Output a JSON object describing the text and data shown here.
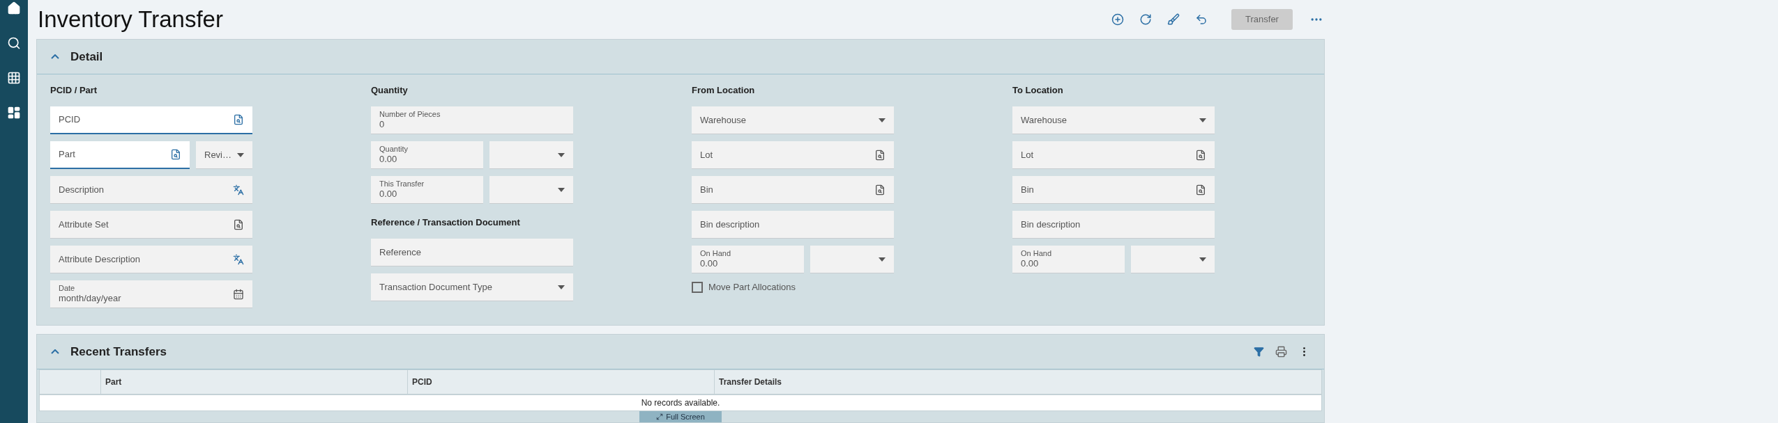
{
  "page": {
    "title": "Inventory Transfer"
  },
  "toolbar": {
    "transfer_button": {
      "label": "Transfer",
      "disabled": true
    }
  },
  "detail": {
    "title": "Detail",
    "expanded": true,
    "columns": [
      {
        "items": [
          {
            "kind": "heading",
            "text": "PCID / Part"
          },
          {
            "kind": "row",
            "fields": [
              {
                "kind": "lookup",
                "placeholder": "PCID",
                "active": true
              }
            ]
          },
          {
            "kind": "row",
            "fields": [
              {
                "kind": "lookup",
                "placeholder": "Part",
                "active": true
              },
              {
                "kind": "select",
                "placeholder": "Revi…",
                "active": false
              }
            ]
          },
          {
            "kind": "row",
            "fields": [
              {
                "kind": "translate",
                "placeholder": "Description",
                "active": false
              }
            ]
          },
          {
            "kind": "row",
            "fields": [
              {
                "kind": "lookup",
                "placeholder": "Attribute Set",
                "active": false
              }
            ]
          },
          {
            "kind": "row",
            "fields": [
              {
                "kind": "translate",
                "placeholder": "Attribute Description",
                "active": false
              }
            ]
          },
          {
            "kind": "row",
            "fields": [
              {
                "kind": "date",
                "label": "Date",
                "placeholder": "month/day/year",
                "active": false
              }
            ]
          }
        ]
      },
      {
        "items": [
          {
            "kind": "heading",
            "text": "Quantity"
          },
          {
            "kind": "row",
            "fields": [
              {
                "kind": "number",
                "label": "Number of Pieces",
                "value": "0",
                "active": false
              }
            ]
          },
          {
            "kind": "row",
            "fields": [
              {
                "kind": "number",
                "label": "Quantity",
                "value": "0.00",
                "active": false
              },
              {
                "kind": "unit",
                "active": false
              }
            ]
          },
          {
            "kind": "row",
            "fields": [
              {
                "kind": "number",
                "label": "This Transfer",
                "value": "0.00",
                "active": false
              },
              {
                "kind": "unit",
                "active": false
              }
            ]
          },
          {
            "kind": "heading",
            "text": "Reference / Transaction Document"
          },
          {
            "kind": "row",
            "fields": [
              {
                "kind": "text",
                "placeholder": "Reference",
                "active": false
              }
            ]
          },
          {
            "kind": "row",
            "fields": [
              {
                "kind": "select",
                "placeholder": "Transaction Document Type",
                "active": false
              }
            ]
          }
        ]
      },
      {
        "items": [
          {
            "kind": "heading",
            "text": "From Location"
          },
          {
            "kind": "row",
            "fields": [
              {
                "kind": "select",
                "placeholder": "Warehouse",
                "active": false
              }
            ]
          },
          {
            "kind": "row",
            "fields": [
              {
                "kind": "lookup",
                "placeholder": "Lot",
                "active": false
              }
            ]
          },
          {
            "kind": "row",
            "fields": [
              {
                "kind": "lookup",
                "placeholder": "Bin",
                "active": false
              }
            ]
          },
          {
            "kind": "row",
            "fields": [
              {
                "kind": "text",
                "placeholder": "Bin description",
                "active": false
              }
            ]
          },
          {
            "kind": "row",
            "fields": [
              {
                "kind": "number",
                "label": "On Hand",
                "value": "0.00",
                "active": false
              },
              {
                "kind": "unit",
                "active": false
              }
            ]
          },
          {
            "kind": "checkbox",
            "label": "Move Part Allocations",
            "checked": false
          }
        ]
      },
      {
        "items": [
          {
            "kind": "heading",
            "text": "To Location"
          },
          {
            "kind": "row",
            "fields": [
              {
                "kind": "select",
                "placeholder": "Warehouse",
                "active": false
              }
            ]
          },
          {
            "kind": "row",
            "fields": [
              {
                "kind": "lookup",
                "placeholder": "Lot",
                "active": false
              }
            ]
          },
          {
            "kind": "row",
            "fields": [
              {
                "kind": "lookup",
                "placeholder": "Bin",
                "active": false
              }
            ]
          },
          {
            "kind": "row",
            "fields": [
              {
                "kind": "text",
                "placeholder": "Bin description",
                "active": false
              }
            ]
          },
          {
            "kind": "row",
            "fields": [
              {
                "kind": "number",
                "label": "On Hand",
                "value": "0.00",
                "active": false
              },
              {
                "kind": "unit",
                "active": false
              }
            ]
          }
        ]
      }
    ]
  },
  "recent": {
    "title": "Recent Transfers",
    "expanded": true,
    "table": {
      "columns": [
        "Part",
        "PCID",
        "Transfer Details"
      ],
      "empty_text": "No records available."
    },
    "full_screen_button": "Full Screen"
  }
}
